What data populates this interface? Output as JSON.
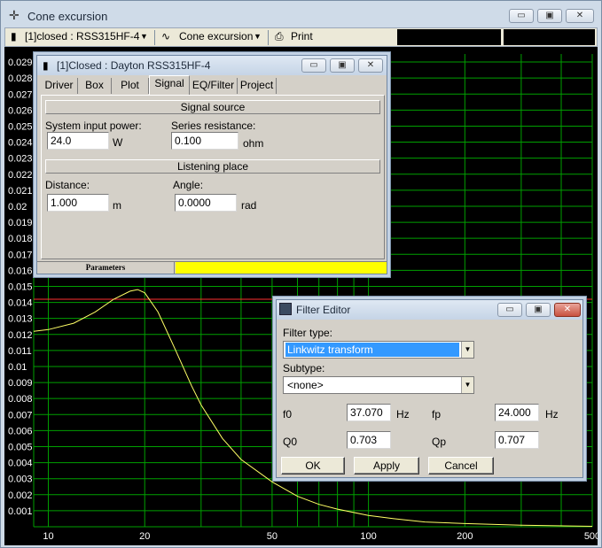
{
  "main_window": {
    "title": "Cone excursion",
    "buttons": {
      "minimize": "▭",
      "maximize": "▣",
      "close": "✕"
    }
  },
  "toolbar": {
    "driver_select": "[1]closed : RSS315HF-4",
    "plot_select": "Cone excursion",
    "print_label": "Print"
  },
  "chart_data": {
    "type": "line",
    "xscale": "log",
    "xlim": [
      9,
      500
    ],
    "ylim": [
      0,
      0.0295
    ],
    "x_ticks": [
      "10",
      "20",
      "50",
      "100",
      "200",
      "500"
    ],
    "y_ticks": [
      "0.029",
      "0.028",
      "0.027",
      "0.026",
      "0.025",
      "0.024",
      "0.023",
      "0.022",
      "0.021",
      "0.02",
      "0.019",
      "0.018",
      "0.017",
      "0.016",
      "0.015",
      "0.014",
      "0.013",
      "0.012",
      "0.011",
      "0.01",
      "0.009",
      "0.008",
      "0.007",
      "0.006",
      "0.005",
      "0.004",
      "0.003",
      "0.002",
      "0.001"
    ],
    "grid": true,
    "colors": {
      "background": "#000000",
      "grid": "#00a000",
      "curve": "#ffff66",
      "limit": "#ff3030"
    },
    "limit_line": 0.0142,
    "series": [
      {
        "x": [
          9,
          10,
          12,
          14,
          16,
          18,
          19,
          20,
          22,
          25,
          28,
          30,
          35,
          40,
          50,
          60,
          70,
          80,
          100,
          120,
          150,
          200,
          300,
          500
        ],
        "y": [
          0.0122,
          0.0123,
          0.0127,
          0.0134,
          0.0142,
          0.0147,
          0.0148,
          0.0146,
          0.0134,
          0.011,
          0.0088,
          0.0076,
          0.0055,
          0.0042,
          0.0028,
          0.0019,
          0.0014,
          0.0011,
          0.0007,
          0.0005,
          0.0003,
          0.0002,
          0.0001,
          3e-05
        ]
      }
    ]
  },
  "driver_window": {
    "title": "[1]Closed : Dayton RSS315HF-4",
    "tabs": [
      "Driver",
      "Box",
      "Plot",
      "Signal",
      "EQ/Filter",
      "Project"
    ],
    "signal_source_header": "Signal source",
    "system_input_power_label": "System input power:",
    "system_input_power_value": "24.0",
    "power_unit": "W",
    "series_resistance_label": "Series resistance:",
    "series_resistance_value": "0.100",
    "resistance_unit": "ohm",
    "listening_place_header": "Listening place",
    "distance_label": "Distance:",
    "distance_value": "1.000",
    "distance_unit": "m",
    "angle_label": "Angle:",
    "angle_value": "0.0000",
    "angle_unit": "rad",
    "status_label": "Parameters",
    "status_color": "#ffff00"
  },
  "filter_editor": {
    "title": "Filter Editor",
    "filter_type_label": "Filter type:",
    "filter_type_value": "Linkwitz transform",
    "subtype_label": "Subtype:",
    "subtype_value": "<none>",
    "f0_label": "f0",
    "f0_value": "37.070",
    "f0_unit": "Hz",
    "fp_label": "fp",
    "fp_value": "24.000",
    "fp_unit": "Hz",
    "q0_label": "Q0",
    "q0_value": "0.703",
    "qp_label": "Qp",
    "qp_value": "0.707",
    "ok_label": "OK",
    "apply_label": "Apply",
    "cancel_label": "Cancel"
  }
}
